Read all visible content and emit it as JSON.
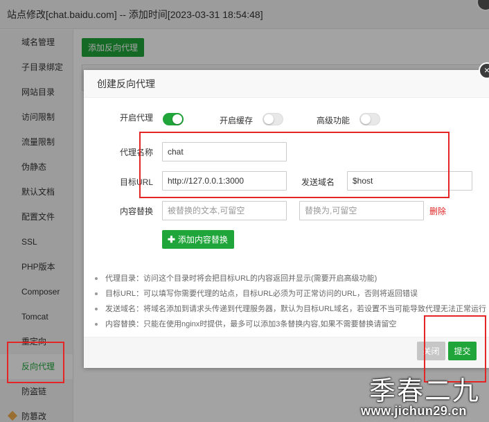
{
  "outer_window": {
    "title": "站点修改[chat.baidu.com] -- 添加时间[2023-03-31 18:54:48]",
    "add_proxy_label": "添加反向代理",
    "sidebar": [
      {
        "label": "域名管理"
      },
      {
        "label": "子目录绑定"
      },
      {
        "label": "网站目录"
      },
      {
        "label": "访问限制"
      },
      {
        "label": "流量限制"
      },
      {
        "label": "伪静态"
      },
      {
        "label": "默认文档"
      },
      {
        "label": "配置文件"
      },
      {
        "label": "SSL"
      },
      {
        "label": "PHP版本"
      },
      {
        "label": "Composer"
      },
      {
        "label": "Tomcat"
      },
      {
        "label": "重定向"
      },
      {
        "label": "反向代理"
      },
      {
        "label": "防盗链"
      },
      {
        "label": "防篡改"
      }
    ],
    "active_sidebar_item": "反向代理"
  },
  "modal": {
    "title": "创建反向代理",
    "close_glyph": "×",
    "toggles": {
      "enable_proxy": {
        "label": "开启代理",
        "on": true
      },
      "enable_cache": {
        "label": "开启缓存",
        "on": false
      },
      "advanced": {
        "label": "高级功能",
        "on": false
      }
    },
    "fields": {
      "proxy_name": {
        "label": "代理名称",
        "value": "chat"
      },
      "target_url": {
        "label": "目标URL",
        "value": "http://127.0.0.1:3000"
      },
      "send_domain": {
        "label": "发送域名",
        "value": "$host"
      },
      "content_replace": {
        "label": "内容替换",
        "from_placeholder": "被替换的文本,可留空",
        "to_placeholder": "替换为,可留空",
        "delete_label": "删除"
      }
    },
    "add_replace_label": "添加内容替换",
    "add_replace_icon": "plus-icon",
    "tips": [
      "代理目录：访问这个目录时将会把目标URL的内容返回并显示(需要开启高级功能)",
      "目标URL：可以填写你需要代理的站点，目标URL必须为可正常访问的URL，否则将返回错误",
      "发送域名：将域名添加到请求头传递到代理服务器，默认为目标URL域名，若设置不当可能导致代理无法正常运行",
      "内容替换：只能在使用nginx时提供，最多可以添加3条替换内容,如果不需要替换请留空"
    ],
    "buttons": {
      "close_label": "关闭",
      "submit_label": "提交"
    }
  },
  "colors": {
    "accent_green": "#20a53a",
    "annotation_red": "#e52525",
    "delete_red": "#e02424"
  },
  "watermark": {
    "text": "季春二九",
    "url": "www.jichun29.cn"
  }
}
